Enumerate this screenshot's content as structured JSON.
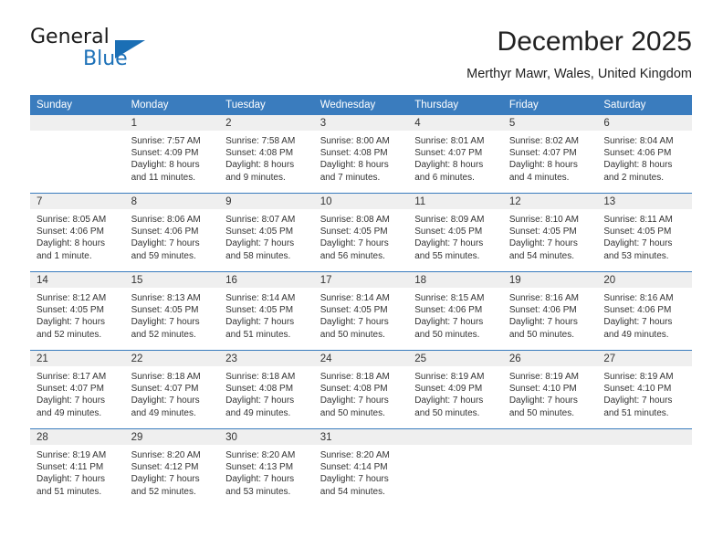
{
  "logo": {
    "word_one": "General",
    "word_two": "Blue",
    "triangle_icon": "triangle-icon",
    "brand_color": "#1b6fb5"
  },
  "header": {
    "month_title": "December 2025",
    "location": "Merthyr Mawr, Wales, United Kingdom"
  },
  "theme": {
    "header_blue": "#3a7cbe",
    "day_band_gray": "#efefef",
    "text": "#333333"
  },
  "weekday_headers": [
    "Sunday",
    "Monday",
    "Tuesday",
    "Wednesday",
    "Thursday",
    "Friday",
    "Saturday"
  ],
  "weeks": [
    [
      {
        "day": "",
        "sunrise": "",
        "sunset": "",
        "daylight_line1": "",
        "daylight_line2": ""
      },
      {
        "day": "1",
        "sunrise": "Sunrise: 7:57 AM",
        "sunset": "Sunset: 4:09 PM",
        "daylight_line1": "Daylight: 8 hours",
        "daylight_line2": "and 11 minutes."
      },
      {
        "day": "2",
        "sunrise": "Sunrise: 7:58 AM",
        "sunset": "Sunset: 4:08 PM",
        "daylight_line1": "Daylight: 8 hours",
        "daylight_line2": "and 9 minutes."
      },
      {
        "day": "3",
        "sunrise": "Sunrise: 8:00 AM",
        "sunset": "Sunset: 4:08 PM",
        "daylight_line1": "Daylight: 8 hours",
        "daylight_line2": "and 7 minutes."
      },
      {
        "day": "4",
        "sunrise": "Sunrise: 8:01 AM",
        "sunset": "Sunset: 4:07 PM",
        "daylight_line1": "Daylight: 8 hours",
        "daylight_line2": "and 6 minutes."
      },
      {
        "day": "5",
        "sunrise": "Sunrise: 8:02 AM",
        "sunset": "Sunset: 4:07 PM",
        "daylight_line1": "Daylight: 8 hours",
        "daylight_line2": "and 4 minutes."
      },
      {
        "day": "6",
        "sunrise": "Sunrise: 8:04 AM",
        "sunset": "Sunset: 4:06 PM",
        "daylight_line1": "Daylight: 8 hours",
        "daylight_line2": "and 2 minutes."
      }
    ],
    [
      {
        "day": "7",
        "sunrise": "Sunrise: 8:05 AM",
        "sunset": "Sunset: 4:06 PM",
        "daylight_line1": "Daylight: 8 hours",
        "daylight_line2": "and 1 minute."
      },
      {
        "day": "8",
        "sunrise": "Sunrise: 8:06 AM",
        "sunset": "Sunset: 4:06 PM",
        "daylight_line1": "Daylight: 7 hours",
        "daylight_line2": "and 59 minutes."
      },
      {
        "day": "9",
        "sunrise": "Sunrise: 8:07 AM",
        "sunset": "Sunset: 4:05 PM",
        "daylight_line1": "Daylight: 7 hours",
        "daylight_line2": "and 58 minutes."
      },
      {
        "day": "10",
        "sunrise": "Sunrise: 8:08 AM",
        "sunset": "Sunset: 4:05 PM",
        "daylight_line1": "Daylight: 7 hours",
        "daylight_line2": "and 56 minutes."
      },
      {
        "day": "11",
        "sunrise": "Sunrise: 8:09 AM",
        "sunset": "Sunset: 4:05 PM",
        "daylight_line1": "Daylight: 7 hours",
        "daylight_line2": "and 55 minutes."
      },
      {
        "day": "12",
        "sunrise": "Sunrise: 8:10 AM",
        "sunset": "Sunset: 4:05 PM",
        "daylight_line1": "Daylight: 7 hours",
        "daylight_line2": "and 54 minutes."
      },
      {
        "day": "13",
        "sunrise": "Sunrise: 8:11 AM",
        "sunset": "Sunset: 4:05 PM",
        "daylight_line1": "Daylight: 7 hours",
        "daylight_line2": "and 53 minutes."
      }
    ],
    [
      {
        "day": "14",
        "sunrise": "Sunrise: 8:12 AM",
        "sunset": "Sunset: 4:05 PM",
        "daylight_line1": "Daylight: 7 hours",
        "daylight_line2": "and 52 minutes."
      },
      {
        "day": "15",
        "sunrise": "Sunrise: 8:13 AM",
        "sunset": "Sunset: 4:05 PM",
        "daylight_line1": "Daylight: 7 hours",
        "daylight_line2": "and 52 minutes."
      },
      {
        "day": "16",
        "sunrise": "Sunrise: 8:14 AM",
        "sunset": "Sunset: 4:05 PM",
        "daylight_line1": "Daylight: 7 hours",
        "daylight_line2": "and 51 minutes."
      },
      {
        "day": "17",
        "sunrise": "Sunrise: 8:14 AM",
        "sunset": "Sunset: 4:05 PM",
        "daylight_line1": "Daylight: 7 hours",
        "daylight_line2": "and 50 minutes."
      },
      {
        "day": "18",
        "sunrise": "Sunrise: 8:15 AM",
        "sunset": "Sunset: 4:06 PM",
        "daylight_line1": "Daylight: 7 hours",
        "daylight_line2": "and 50 minutes."
      },
      {
        "day": "19",
        "sunrise": "Sunrise: 8:16 AM",
        "sunset": "Sunset: 4:06 PM",
        "daylight_line1": "Daylight: 7 hours",
        "daylight_line2": "and 50 minutes."
      },
      {
        "day": "20",
        "sunrise": "Sunrise: 8:16 AM",
        "sunset": "Sunset: 4:06 PM",
        "daylight_line1": "Daylight: 7 hours",
        "daylight_line2": "and 49 minutes."
      }
    ],
    [
      {
        "day": "21",
        "sunrise": "Sunrise: 8:17 AM",
        "sunset": "Sunset: 4:07 PM",
        "daylight_line1": "Daylight: 7 hours",
        "daylight_line2": "and 49 minutes."
      },
      {
        "day": "22",
        "sunrise": "Sunrise: 8:18 AM",
        "sunset": "Sunset: 4:07 PM",
        "daylight_line1": "Daylight: 7 hours",
        "daylight_line2": "and 49 minutes."
      },
      {
        "day": "23",
        "sunrise": "Sunrise: 8:18 AM",
        "sunset": "Sunset: 4:08 PM",
        "daylight_line1": "Daylight: 7 hours",
        "daylight_line2": "and 49 minutes."
      },
      {
        "day": "24",
        "sunrise": "Sunrise: 8:18 AM",
        "sunset": "Sunset: 4:08 PM",
        "daylight_line1": "Daylight: 7 hours",
        "daylight_line2": "and 50 minutes."
      },
      {
        "day": "25",
        "sunrise": "Sunrise: 8:19 AM",
        "sunset": "Sunset: 4:09 PM",
        "daylight_line1": "Daylight: 7 hours",
        "daylight_line2": "and 50 minutes."
      },
      {
        "day": "26",
        "sunrise": "Sunrise: 8:19 AM",
        "sunset": "Sunset: 4:10 PM",
        "daylight_line1": "Daylight: 7 hours",
        "daylight_line2": "and 50 minutes."
      },
      {
        "day": "27",
        "sunrise": "Sunrise: 8:19 AM",
        "sunset": "Sunset: 4:10 PM",
        "daylight_line1": "Daylight: 7 hours",
        "daylight_line2": "and 51 minutes."
      }
    ],
    [
      {
        "day": "28",
        "sunrise": "Sunrise: 8:19 AM",
        "sunset": "Sunset: 4:11 PM",
        "daylight_line1": "Daylight: 7 hours",
        "daylight_line2": "and 51 minutes."
      },
      {
        "day": "29",
        "sunrise": "Sunrise: 8:20 AM",
        "sunset": "Sunset: 4:12 PM",
        "daylight_line1": "Daylight: 7 hours",
        "daylight_line2": "and 52 minutes."
      },
      {
        "day": "30",
        "sunrise": "Sunrise: 8:20 AM",
        "sunset": "Sunset: 4:13 PM",
        "daylight_line1": "Daylight: 7 hours",
        "daylight_line2": "and 53 minutes."
      },
      {
        "day": "31",
        "sunrise": "Sunrise: 8:20 AM",
        "sunset": "Sunset: 4:14 PM",
        "daylight_line1": "Daylight: 7 hours",
        "daylight_line2": "and 54 minutes."
      },
      {
        "day": "",
        "sunrise": "",
        "sunset": "",
        "daylight_line1": "",
        "daylight_line2": ""
      },
      {
        "day": "",
        "sunrise": "",
        "sunset": "",
        "daylight_line1": "",
        "daylight_line2": ""
      },
      {
        "day": "",
        "sunrise": "",
        "sunset": "",
        "daylight_line1": "",
        "daylight_line2": ""
      }
    ]
  ]
}
